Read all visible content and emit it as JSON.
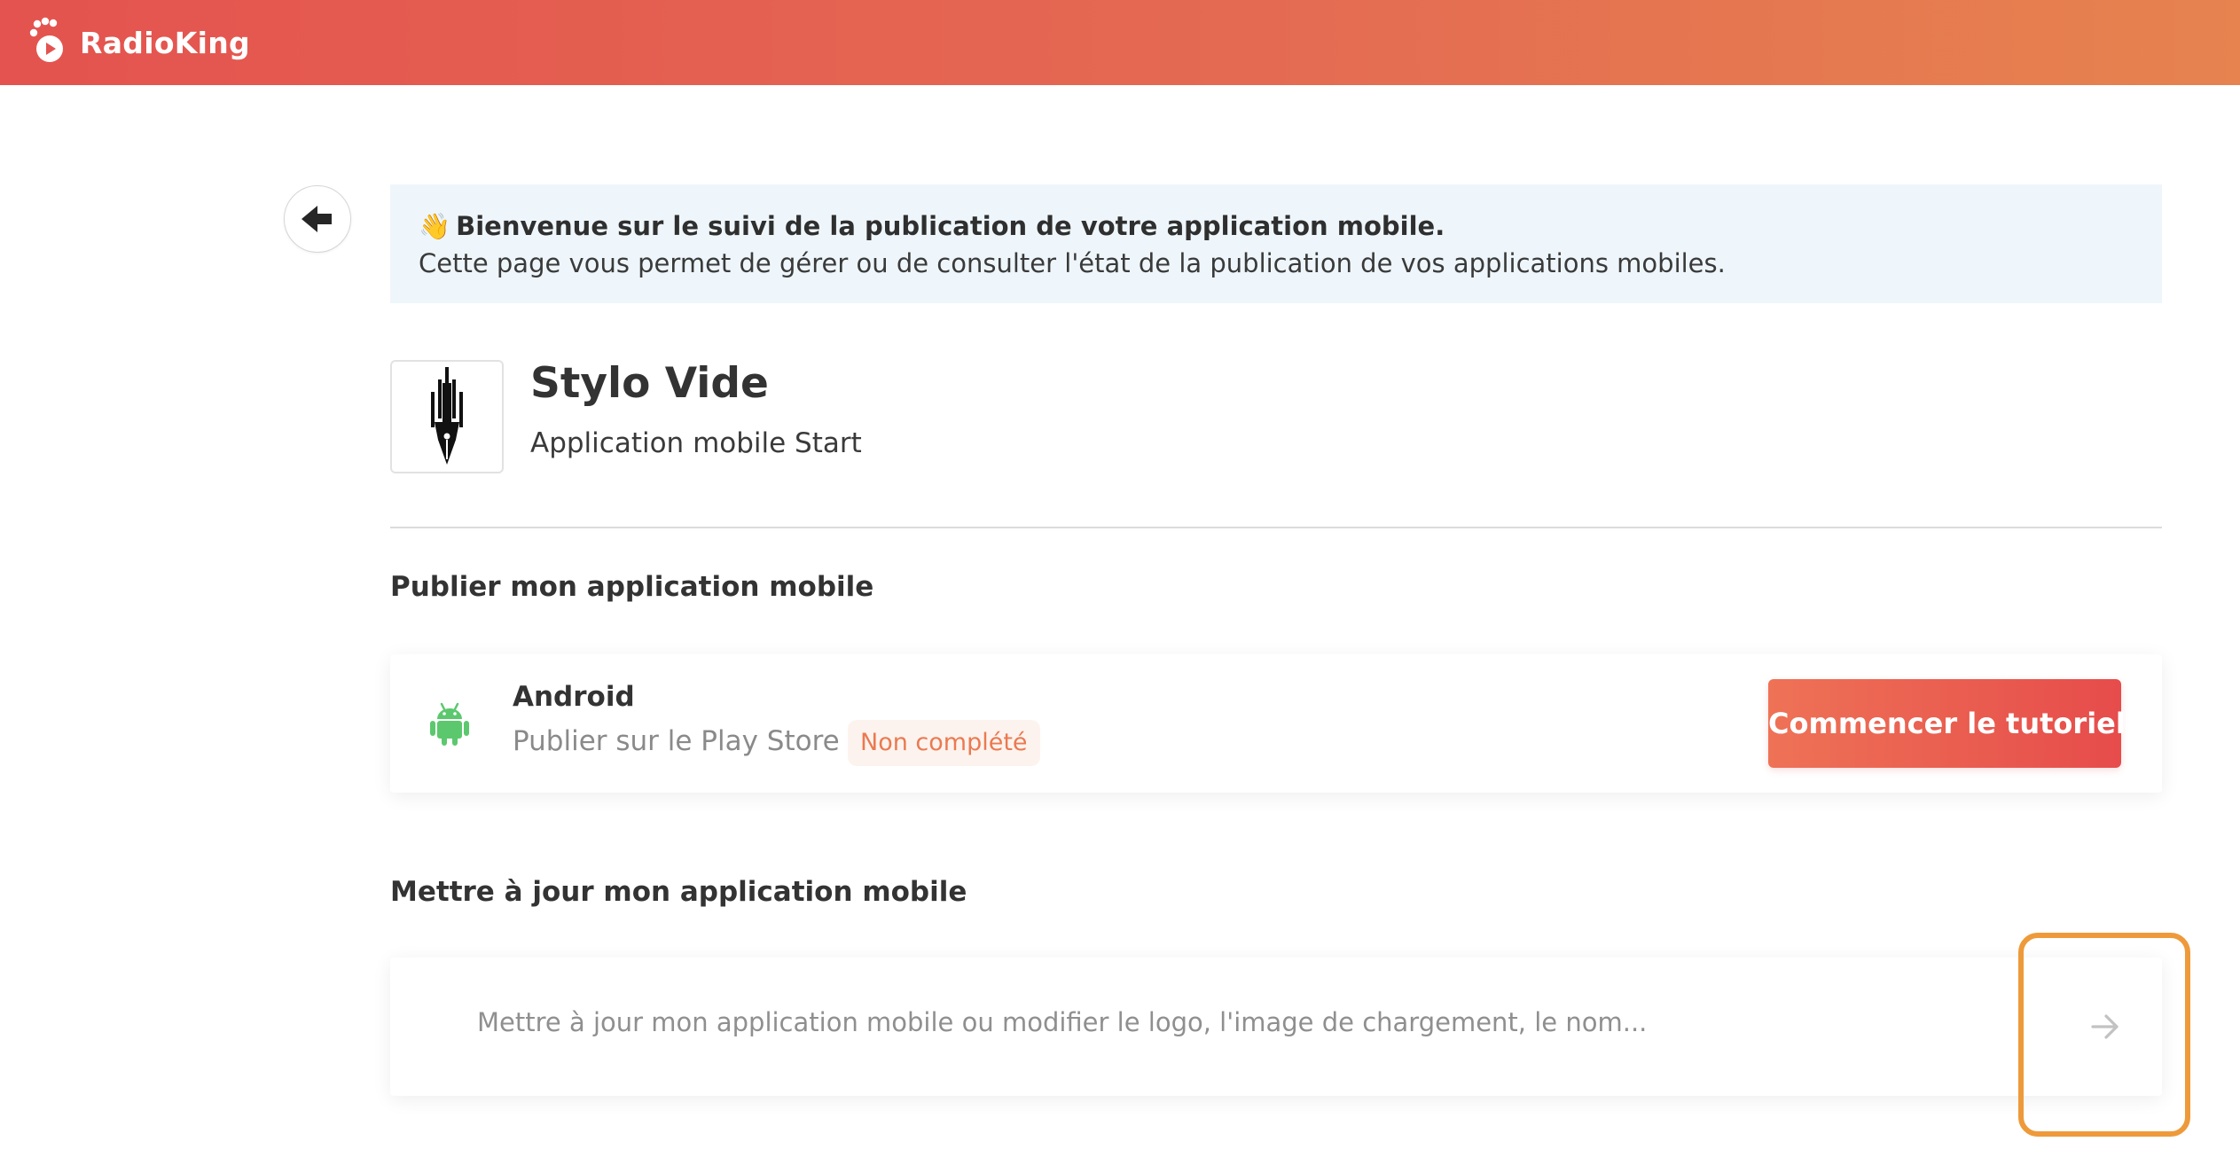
{
  "header": {
    "brand_name": "RadioKing",
    "logo_icon": "crown-radio-icon",
    "gradient_colors": [
      "#e4534f",
      "#e6834f"
    ]
  },
  "back_button": {
    "icon": "arrow-left-icon"
  },
  "welcome": {
    "emoji": "👋",
    "title": "Bienvenue sur le suivi de la publication de votre application mobile.",
    "text": "Cette page vous permet de gérer ou de consulter l'état de la publication de vos applications mobiles."
  },
  "app": {
    "logo_icon": "pen-nib-logo-icon",
    "name": "Stylo Vide",
    "subtitle": "Application mobile Start"
  },
  "publish_section": {
    "title": "Publier mon application mobile",
    "platform": {
      "icon": "android-icon",
      "name": "Android",
      "description": "Publier sur le Play Store",
      "status": "Non complété",
      "action_label": "Commencer le tutoriel"
    }
  },
  "update_section": {
    "title": "Mettre à jour mon application mobile",
    "description": "Mettre à jour mon application mobile ou modifier le logo, l'image de chargement, le nom...",
    "arrow_icon": "arrow-right-icon"
  },
  "colors": {
    "accent": "#e64c4b",
    "status_text": "#ea7a51",
    "android_green": "#5cc86e",
    "highlight": "#ee9a3a",
    "welcome_bg": "#eef6fb"
  }
}
